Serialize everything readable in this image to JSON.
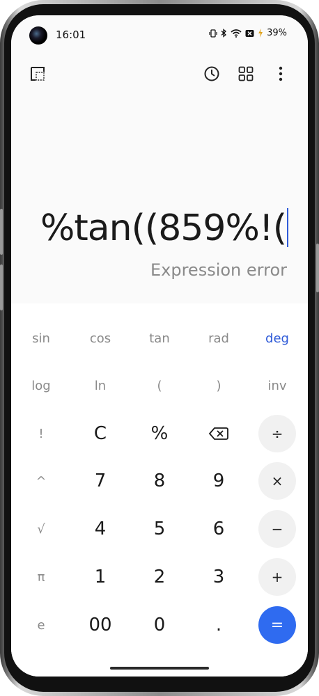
{
  "status_bar": {
    "time": "16:01",
    "battery": "39%",
    "icons": [
      "vibrate-icon",
      "bluetooth-icon",
      "wifi-icon",
      "sim-off-icon",
      "charging-icon"
    ]
  },
  "app_bar": {
    "left_icon": "crop-mode-icon",
    "right_icons": [
      "history-icon",
      "converter-grid-icon",
      "more-vertical-icon"
    ]
  },
  "display": {
    "expression": "%tan((859%!(",
    "result": "Expression error"
  },
  "keypad": {
    "sci_row1": [
      "sin",
      "cos",
      "tan",
      "rad",
      "deg"
    ],
    "sci_row2": [
      "log",
      "ln",
      "(",
      ")",
      "inv"
    ],
    "row3": [
      "!",
      "C",
      "%",
      "backspace",
      "÷"
    ],
    "row4": [
      "^",
      "7",
      "8",
      "9",
      "×"
    ],
    "row5": [
      "√",
      "4",
      "5",
      "6",
      "−"
    ],
    "row6": [
      "π",
      "1",
      "2",
      "3",
      "+"
    ],
    "row7": [
      "e",
      "00",
      "0",
      ".",
      "="
    ]
  },
  "colors": {
    "accent": "#2f6bf0",
    "deg_active": "#2f5bd8",
    "error_text": "#8a8a8a"
  }
}
